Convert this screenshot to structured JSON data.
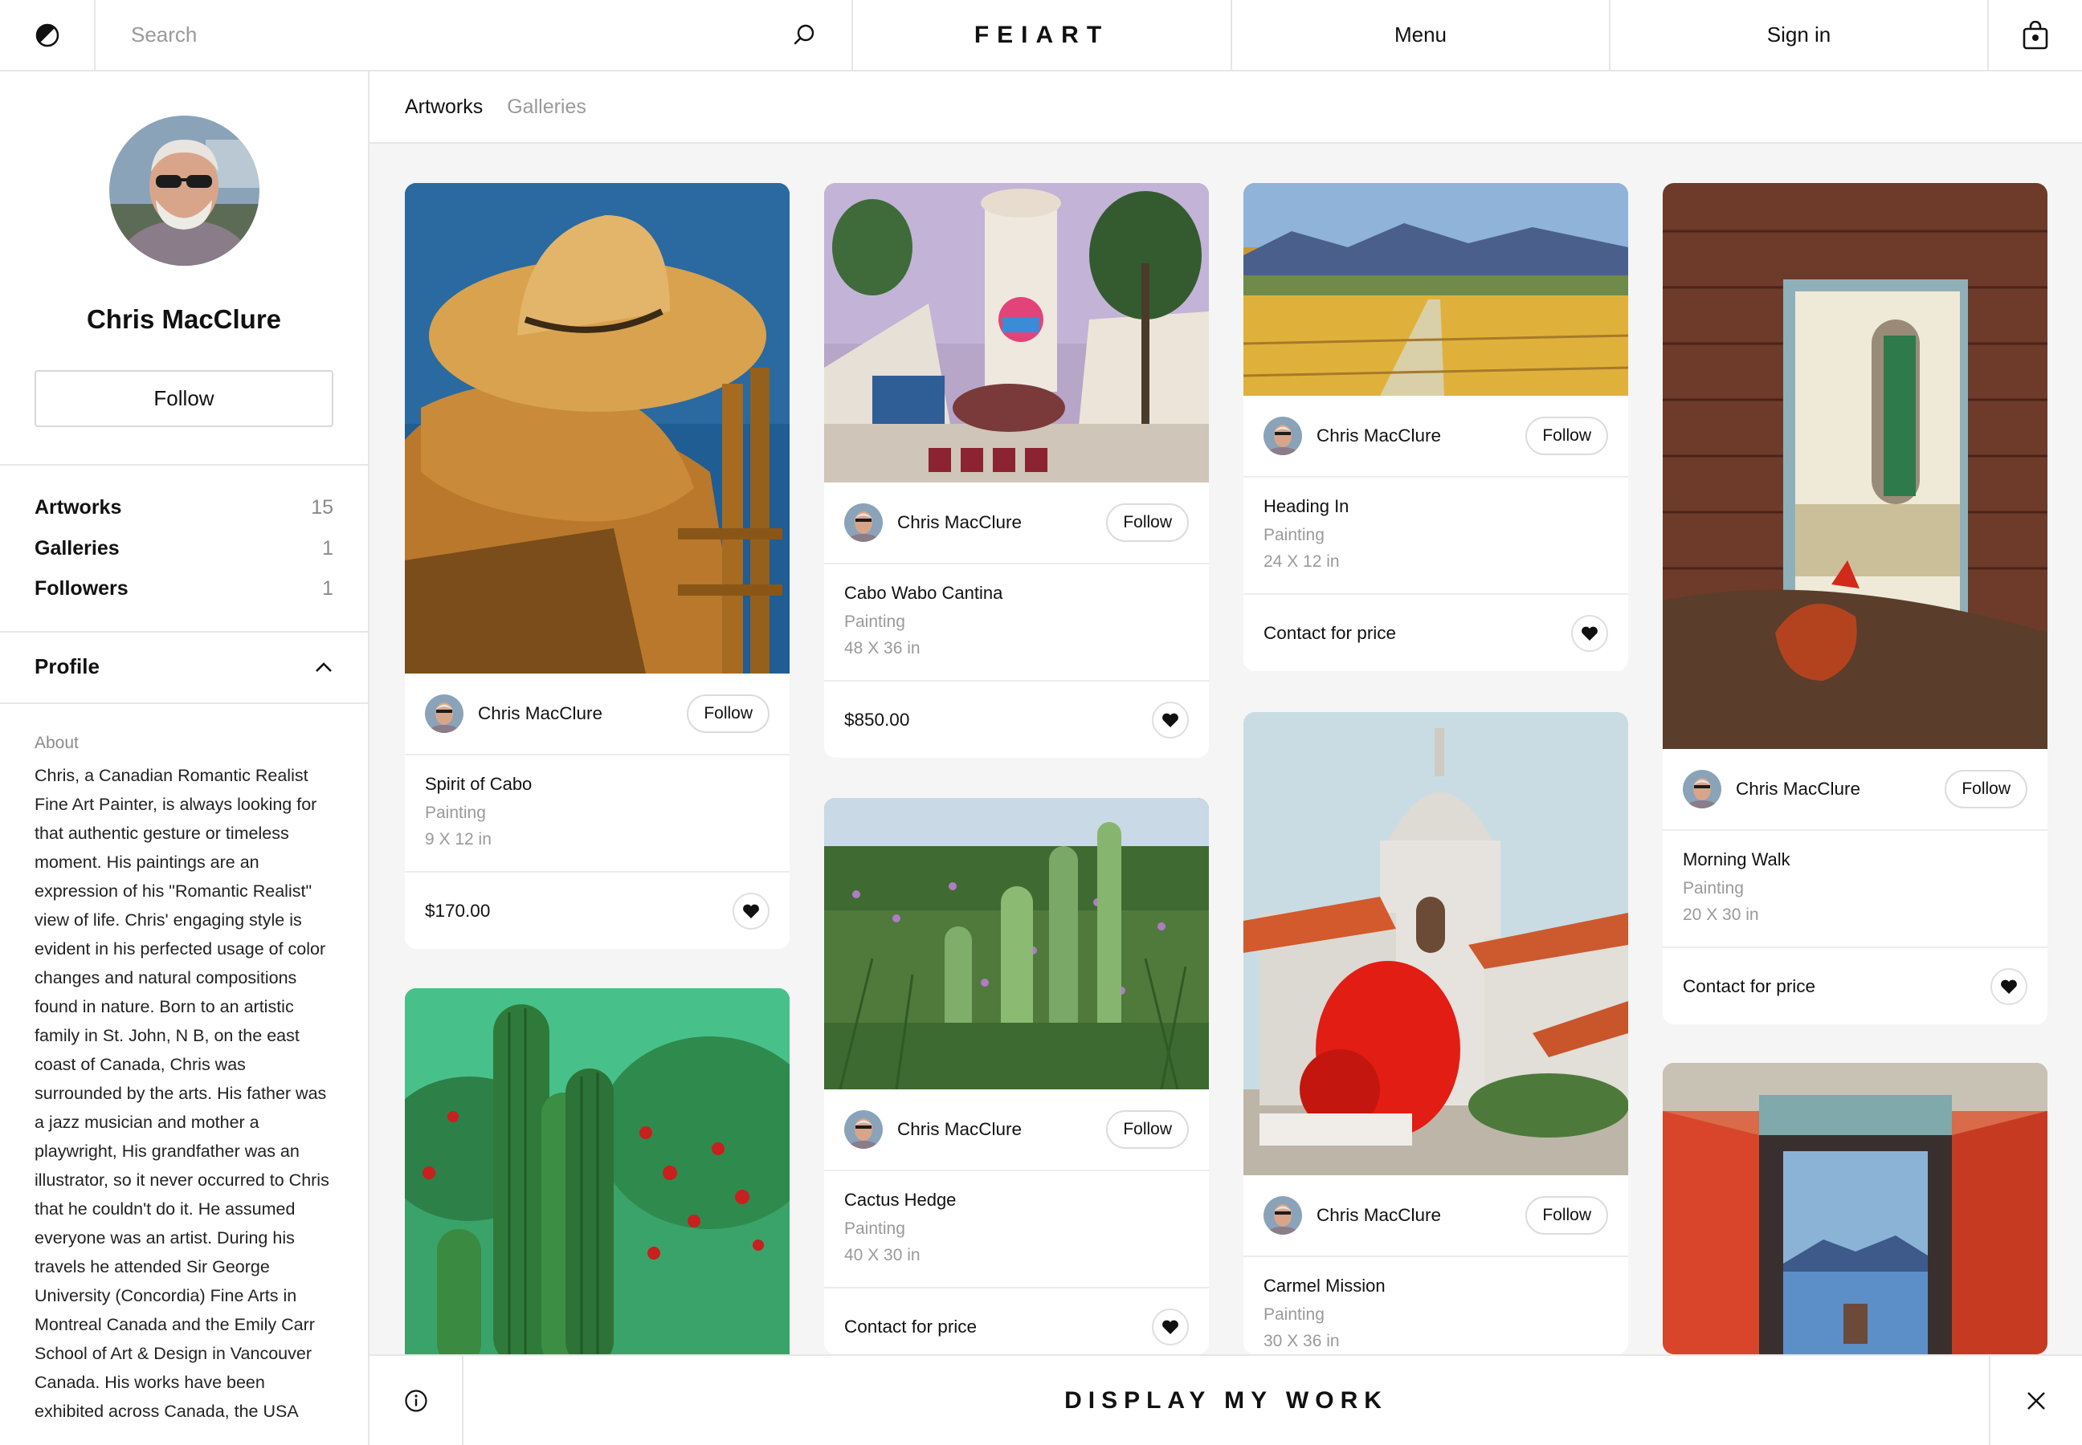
{
  "header": {
    "search_placeholder": "Search",
    "logo": "FEIART",
    "menu_label": "Menu",
    "signin_label": "Sign in",
    "icons": [
      "theme-toggle-icon",
      "search-icon",
      "shopping-bag-icon"
    ]
  },
  "profile": {
    "name": "Chris MacClure",
    "follow_label": "Follow",
    "stats": [
      {
        "label": "Artworks",
        "value": "15"
      },
      {
        "label": "Galleries",
        "value": "1"
      },
      {
        "label": "Followers",
        "value": "1"
      }
    ],
    "section_title": "Profile",
    "about_label": "About",
    "about_text": "Chris, a Canadian Romantic Realist Fine Art Painter, is always looking for that authentic gesture or timeless moment. His paintings are an expression of his \"Romantic Realist\" view of life. Chris' engaging style is evident in his perfected usage of color changes and natural compositions found in nature. Born to an artistic family in St. John, N B, on the east coast of Canada, Chris was surrounded by the arts. His father was a jazz musician and mother a playwright, His grandfather was an illustrator, so it never occurred to Chris that he couldn't do it. He assumed everyone was an artist. During his travels he attended Sir George University (Concordia) Fine Arts in Montreal Canada and the Emily Carr School of Art & Design in Vancouver Canada. His works have been exhibited across Canada, the USA"
  },
  "tabs": {
    "artworks": "Artworks",
    "galleries": "Galleries"
  },
  "cards": [
    {
      "artist": "Chris MacClure",
      "follow": "Follow",
      "title": "Spirit of Cabo",
      "medium": "Painting",
      "size": "9 X 12 in",
      "price": "$170.00"
    },
    {
      "artist": "Chris MacClure",
      "follow": "Follow",
      "title": "Cabo Wabo Cantina",
      "medium": "Painting",
      "size": "48 X 36 in",
      "price": "$850.00"
    },
    {
      "artist": "Chris MacClure",
      "follow": "Follow",
      "title": "Heading In",
      "medium": "Painting",
      "size": "24 X 12 in",
      "price": "Contact for price"
    },
    {
      "artist": "Chris MacClure",
      "follow": "Follow",
      "title": "Morning Walk",
      "medium": "Painting",
      "size": "20 X 30 in",
      "price": "Contact for price"
    },
    {
      "artist": "Chris MacClure",
      "follow": "Follow",
      "title": "Cactus Hedge",
      "medium": "Painting",
      "size": "40 X 30 in",
      "price": "Contact for price"
    },
    {
      "artist": "Chris MacClure",
      "follow": "Follow",
      "title": "Carmel Mission",
      "medium": "Painting",
      "size": "30 X 36 in"
    }
  ],
  "bottom_bar": {
    "cta": "DISPLAY MY WORK",
    "icons": [
      "info-icon",
      "close-icon"
    ]
  }
}
